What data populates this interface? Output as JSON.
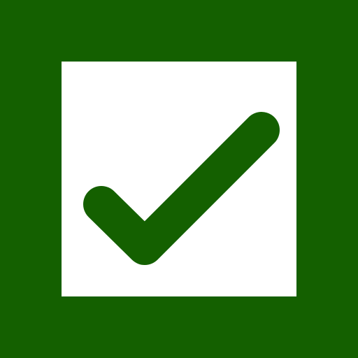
{
  "icon": {
    "name": "checkbox-checked-icon",
    "state": "checked"
  },
  "colors": {
    "background": "#146000",
    "box": "#ffffff",
    "check": "#146000"
  }
}
